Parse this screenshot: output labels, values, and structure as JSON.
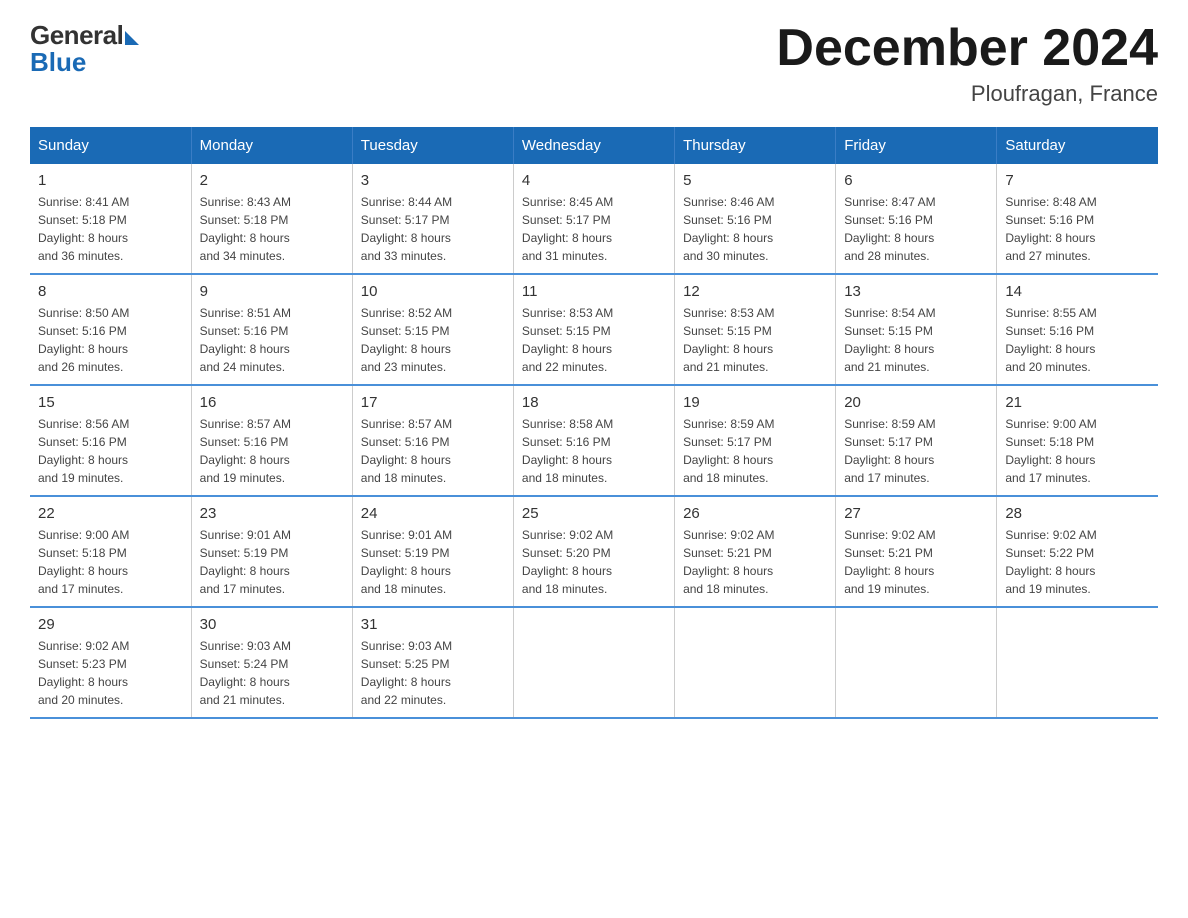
{
  "header": {
    "logo_general": "General",
    "logo_blue": "Blue",
    "month_title": "December 2024",
    "location": "Ploufragan, France"
  },
  "weekdays": [
    "Sunday",
    "Monday",
    "Tuesday",
    "Wednesday",
    "Thursday",
    "Friday",
    "Saturday"
  ],
  "weeks": [
    [
      {
        "day": "1",
        "sunrise": "Sunrise: 8:41 AM",
        "sunset": "Sunset: 5:18 PM",
        "daylight": "Daylight: 8 hours and 36 minutes."
      },
      {
        "day": "2",
        "sunrise": "Sunrise: 8:43 AM",
        "sunset": "Sunset: 5:18 PM",
        "daylight": "Daylight: 8 hours and 34 minutes."
      },
      {
        "day": "3",
        "sunrise": "Sunrise: 8:44 AM",
        "sunset": "Sunset: 5:17 PM",
        "daylight": "Daylight: 8 hours and 33 minutes."
      },
      {
        "day": "4",
        "sunrise": "Sunrise: 8:45 AM",
        "sunset": "Sunset: 5:17 PM",
        "daylight": "Daylight: 8 hours and 31 minutes."
      },
      {
        "day": "5",
        "sunrise": "Sunrise: 8:46 AM",
        "sunset": "Sunset: 5:16 PM",
        "daylight": "Daylight: 8 hours and 30 minutes."
      },
      {
        "day": "6",
        "sunrise": "Sunrise: 8:47 AM",
        "sunset": "Sunset: 5:16 PM",
        "daylight": "Daylight: 8 hours and 28 minutes."
      },
      {
        "day": "7",
        "sunrise": "Sunrise: 8:48 AM",
        "sunset": "Sunset: 5:16 PM",
        "daylight": "Daylight: 8 hours and 27 minutes."
      }
    ],
    [
      {
        "day": "8",
        "sunrise": "Sunrise: 8:50 AM",
        "sunset": "Sunset: 5:16 PM",
        "daylight": "Daylight: 8 hours and 26 minutes."
      },
      {
        "day": "9",
        "sunrise": "Sunrise: 8:51 AM",
        "sunset": "Sunset: 5:16 PM",
        "daylight": "Daylight: 8 hours and 24 minutes."
      },
      {
        "day": "10",
        "sunrise": "Sunrise: 8:52 AM",
        "sunset": "Sunset: 5:15 PM",
        "daylight": "Daylight: 8 hours and 23 minutes."
      },
      {
        "day": "11",
        "sunrise": "Sunrise: 8:53 AM",
        "sunset": "Sunset: 5:15 PM",
        "daylight": "Daylight: 8 hours and 22 minutes."
      },
      {
        "day": "12",
        "sunrise": "Sunrise: 8:53 AM",
        "sunset": "Sunset: 5:15 PM",
        "daylight": "Daylight: 8 hours and 21 minutes."
      },
      {
        "day": "13",
        "sunrise": "Sunrise: 8:54 AM",
        "sunset": "Sunset: 5:15 PM",
        "daylight": "Daylight: 8 hours and 21 minutes."
      },
      {
        "day": "14",
        "sunrise": "Sunrise: 8:55 AM",
        "sunset": "Sunset: 5:16 PM",
        "daylight": "Daylight: 8 hours and 20 minutes."
      }
    ],
    [
      {
        "day": "15",
        "sunrise": "Sunrise: 8:56 AM",
        "sunset": "Sunset: 5:16 PM",
        "daylight": "Daylight: 8 hours and 19 minutes."
      },
      {
        "day": "16",
        "sunrise": "Sunrise: 8:57 AM",
        "sunset": "Sunset: 5:16 PM",
        "daylight": "Daylight: 8 hours and 19 minutes."
      },
      {
        "day": "17",
        "sunrise": "Sunrise: 8:57 AM",
        "sunset": "Sunset: 5:16 PM",
        "daylight": "Daylight: 8 hours and 18 minutes."
      },
      {
        "day": "18",
        "sunrise": "Sunrise: 8:58 AM",
        "sunset": "Sunset: 5:16 PM",
        "daylight": "Daylight: 8 hours and 18 minutes."
      },
      {
        "day": "19",
        "sunrise": "Sunrise: 8:59 AM",
        "sunset": "Sunset: 5:17 PM",
        "daylight": "Daylight: 8 hours and 18 minutes."
      },
      {
        "day": "20",
        "sunrise": "Sunrise: 8:59 AM",
        "sunset": "Sunset: 5:17 PM",
        "daylight": "Daylight: 8 hours and 17 minutes."
      },
      {
        "day": "21",
        "sunrise": "Sunrise: 9:00 AM",
        "sunset": "Sunset: 5:18 PM",
        "daylight": "Daylight: 8 hours and 17 minutes."
      }
    ],
    [
      {
        "day": "22",
        "sunrise": "Sunrise: 9:00 AM",
        "sunset": "Sunset: 5:18 PM",
        "daylight": "Daylight: 8 hours and 17 minutes."
      },
      {
        "day": "23",
        "sunrise": "Sunrise: 9:01 AM",
        "sunset": "Sunset: 5:19 PM",
        "daylight": "Daylight: 8 hours and 17 minutes."
      },
      {
        "day": "24",
        "sunrise": "Sunrise: 9:01 AM",
        "sunset": "Sunset: 5:19 PM",
        "daylight": "Daylight: 8 hours and 18 minutes."
      },
      {
        "day": "25",
        "sunrise": "Sunrise: 9:02 AM",
        "sunset": "Sunset: 5:20 PM",
        "daylight": "Daylight: 8 hours and 18 minutes."
      },
      {
        "day": "26",
        "sunrise": "Sunrise: 9:02 AM",
        "sunset": "Sunset: 5:21 PM",
        "daylight": "Daylight: 8 hours and 18 minutes."
      },
      {
        "day": "27",
        "sunrise": "Sunrise: 9:02 AM",
        "sunset": "Sunset: 5:21 PM",
        "daylight": "Daylight: 8 hours and 19 minutes."
      },
      {
        "day": "28",
        "sunrise": "Sunrise: 9:02 AM",
        "sunset": "Sunset: 5:22 PM",
        "daylight": "Daylight: 8 hours and 19 minutes."
      }
    ],
    [
      {
        "day": "29",
        "sunrise": "Sunrise: 9:02 AM",
        "sunset": "Sunset: 5:23 PM",
        "daylight": "Daylight: 8 hours and 20 minutes."
      },
      {
        "day": "30",
        "sunrise": "Sunrise: 9:03 AM",
        "sunset": "Sunset: 5:24 PM",
        "daylight": "Daylight: 8 hours and 21 minutes."
      },
      {
        "day": "31",
        "sunrise": "Sunrise: 9:03 AM",
        "sunset": "Sunset: 5:25 PM",
        "daylight": "Daylight: 8 hours and 22 minutes."
      },
      null,
      null,
      null,
      null
    ]
  ]
}
